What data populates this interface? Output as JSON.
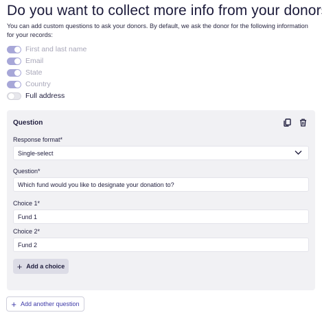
{
  "header": {
    "title": "Do you want to collect more info from your donors?",
    "description": "You can add custom questions to ask your donors. By default, we ask the donor for the following information for your records:"
  },
  "toggles": [
    {
      "label": "First and last name",
      "on": true,
      "disabled": true
    },
    {
      "label": "Email",
      "on": true,
      "disabled": true
    },
    {
      "label": "State",
      "on": true,
      "disabled": true
    },
    {
      "label": "Country",
      "on": true,
      "disabled": true
    },
    {
      "label": "Full address",
      "on": false,
      "disabled": false
    }
  ],
  "question_card": {
    "title": "Question",
    "icons": [
      "copy-icon",
      "trash-icon"
    ],
    "response_format_label": "Response format*",
    "response_format_value": "Single-select",
    "question_label": "Question*",
    "question_value": "Which fund would you like to designate your donation to?",
    "choice1_label": "Choice 1*",
    "choice1_value": "Fund 1",
    "choice2_label": "Choice 2*",
    "choice2_value": "Fund 2",
    "add_choice_label": "Add a choice"
  },
  "add_question_label": "Add another question",
  "colors": {
    "toggle_on": "#a7a7d8",
    "card_bg": "#f1f1f4",
    "accent_text": "#3e3aa8"
  }
}
